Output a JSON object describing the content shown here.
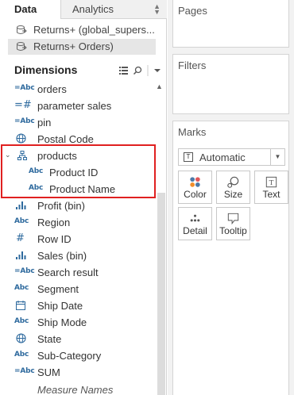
{
  "tabs": {
    "data": "Data",
    "analytics": "Analytics"
  },
  "datasources": [
    {
      "label": "Returns+ (global_supers...",
      "selected": false
    },
    {
      "label": "Returns+ Orders)",
      "selected": true
    }
  ],
  "dimensions": {
    "header": "Dimensions",
    "rows": [
      {
        "icon": "abc-calc-icon",
        "label": "orders"
      },
      {
        "icon": "hash-calc-icon",
        "label": "parameter sales"
      },
      {
        "icon": "abc-calc-icon",
        "label": "pin"
      },
      {
        "icon": "globe-icon",
        "label": "Postal Code"
      },
      {
        "icon": "hierarchy-icon",
        "label": "products"
      },
      {
        "icon": "abc-icon",
        "label": "Product ID"
      },
      {
        "icon": "abc-icon",
        "label": "Product Name"
      },
      {
        "icon": "bin-icon",
        "label": "Profit (bin)"
      },
      {
        "icon": "abc-icon",
        "label": "Region"
      },
      {
        "icon": "hash-icon",
        "label": "Row ID"
      },
      {
        "icon": "bin-icon",
        "label": "Sales (bin)"
      },
      {
        "icon": "abc-calc-icon",
        "label": "Search result"
      },
      {
        "icon": "abc-icon",
        "label": "Segment"
      },
      {
        "icon": "calendar-icon",
        "label": "Ship Date"
      },
      {
        "icon": "abc-icon",
        "label": "Ship Mode"
      },
      {
        "icon": "globe-icon",
        "label": "State"
      },
      {
        "icon": "abc-icon",
        "label": "Sub-Category"
      },
      {
        "icon": "abc-calc-icon",
        "label": "SUM"
      }
    ],
    "partial_label": "Measure Names"
  },
  "right": {
    "pages": "Pages",
    "filters": "Filters",
    "marks": "Marks",
    "mark_type": "Automatic",
    "buttons": {
      "color": "Color",
      "size": "Size",
      "text": "Text",
      "detail": "Detail",
      "tooltip": "Tooltip"
    }
  },
  "colors": {
    "highlight": "#e02020",
    "icon_blue": "#2e6a9e"
  }
}
